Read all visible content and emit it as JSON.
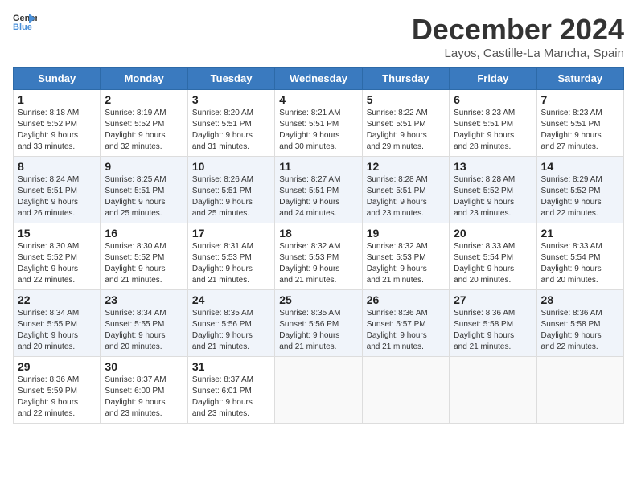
{
  "logo": {
    "text_general": "General",
    "text_blue": "Blue"
  },
  "title": "December 2024",
  "subtitle": "Layos, Castille-La Mancha, Spain",
  "days_of_week": [
    "Sunday",
    "Monday",
    "Tuesday",
    "Wednesday",
    "Thursday",
    "Friday",
    "Saturday"
  ],
  "weeks": [
    [
      {
        "day": "1",
        "info": "Sunrise: 8:18 AM\nSunset: 5:52 PM\nDaylight: 9 hours\nand 33 minutes."
      },
      {
        "day": "2",
        "info": "Sunrise: 8:19 AM\nSunset: 5:52 PM\nDaylight: 9 hours\nand 32 minutes."
      },
      {
        "day": "3",
        "info": "Sunrise: 8:20 AM\nSunset: 5:51 PM\nDaylight: 9 hours\nand 31 minutes."
      },
      {
        "day": "4",
        "info": "Sunrise: 8:21 AM\nSunset: 5:51 PM\nDaylight: 9 hours\nand 30 minutes."
      },
      {
        "day": "5",
        "info": "Sunrise: 8:22 AM\nSunset: 5:51 PM\nDaylight: 9 hours\nand 29 minutes."
      },
      {
        "day": "6",
        "info": "Sunrise: 8:23 AM\nSunset: 5:51 PM\nDaylight: 9 hours\nand 28 minutes."
      },
      {
        "day": "7",
        "info": "Sunrise: 8:23 AM\nSunset: 5:51 PM\nDaylight: 9 hours\nand 27 minutes."
      }
    ],
    [
      {
        "day": "8",
        "info": "Sunrise: 8:24 AM\nSunset: 5:51 PM\nDaylight: 9 hours\nand 26 minutes."
      },
      {
        "day": "9",
        "info": "Sunrise: 8:25 AM\nSunset: 5:51 PM\nDaylight: 9 hours\nand 25 minutes."
      },
      {
        "day": "10",
        "info": "Sunrise: 8:26 AM\nSunset: 5:51 PM\nDaylight: 9 hours\nand 25 minutes."
      },
      {
        "day": "11",
        "info": "Sunrise: 8:27 AM\nSunset: 5:51 PM\nDaylight: 9 hours\nand 24 minutes."
      },
      {
        "day": "12",
        "info": "Sunrise: 8:28 AM\nSunset: 5:51 PM\nDaylight: 9 hours\nand 23 minutes."
      },
      {
        "day": "13",
        "info": "Sunrise: 8:28 AM\nSunset: 5:52 PM\nDaylight: 9 hours\nand 23 minutes."
      },
      {
        "day": "14",
        "info": "Sunrise: 8:29 AM\nSunset: 5:52 PM\nDaylight: 9 hours\nand 22 minutes."
      }
    ],
    [
      {
        "day": "15",
        "info": "Sunrise: 8:30 AM\nSunset: 5:52 PM\nDaylight: 9 hours\nand 22 minutes."
      },
      {
        "day": "16",
        "info": "Sunrise: 8:30 AM\nSunset: 5:52 PM\nDaylight: 9 hours\nand 21 minutes."
      },
      {
        "day": "17",
        "info": "Sunrise: 8:31 AM\nSunset: 5:53 PM\nDaylight: 9 hours\nand 21 minutes."
      },
      {
        "day": "18",
        "info": "Sunrise: 8:32 AM\nSunset: 5:53 PM\nDaylight: 9 hours\nand 21 minutes."
      },
      {
        "day": "19",
        "info": "Sunrise: 8:32 AM\nSunset: 5:53 PM\nDaylight: 9 hours\nand 21 minutes."
      },
      {
        "day": "20",
        "info": "Sunrise: 8:33 AM\nSunset: 5:54 PM\nDaylight: 9 hours\nand 20 minutes."
      },
      {
        "day": "21",
        "info": "Sunrise: 8:33 AM\nSunset: 5:54 PM\nDaylight: 9 hours\nand 20 minutes."
      }
    ],
    [
      {
        "day": "22",
        "info": "Sunrise: 8:34 AM\nSunset: 5:55 PM\nDaylight: 9 hours\nand 20 minutes."
      },
      {
        "day": "23",
        "info": "Sunrise: 8:34 AM\nSunset: 5:55 PM\nDaylight: 9 hours\nand 20 minutes."
      },
      {
        "day": "24",
        "info": "Sunrise: 8:35 AM\nSunset: 5:56 PM\nDaylight: 9 hours\nand 21 minutes."
      },
      {
        "day": "25",
        "info": "Sunrise: 8:35 AM\nSunset: 5:56 PM\nDaylight: 9 hours\nand 21 minutes."
      },
      {
        "day": "26",
        "info": "Sunrise: 8:36 AM\nSunset: 5:57 PM\nDaylight: 9 hours\nand 21 minutes."
      },
      {
        "day": "27",
        "info": "Sunrise: 8:36 AM\nSunset: 5:58 PM\nDaylight: 9 hours\nand 21 minutes."
      },
      {
        "day": "28",
        "info": "Sunrise: 8:36 AM\nSunset: 5:58 PM\nDaylight: 9 hours\nand 22 minutes."
      }
    ],
    [
      {
        "day": "29",
        "info": "Sunrise: 8:36 AM\nSunset: 5:59 PM\nDaylight: 9 hours\nand 22 minutes."
      },
      {
        "day": "30",
        "info": "Sunrise: 8:37 AM\nSunset: 6:00 PM\nDaylight: 9 hours\nand 23 minutes."
      },
      {
        "day": "31",
        "info": "Sunrise: 8:37 AM\nSunset: 6:01 PM\nDaylight: 9 hours\nand 23 minutes."
      },
      {
        "day": "",
        "info": ""
      },
      {
        "day": "",
        "info": ""
      },
      {
        "day": "",
        "info": ""
      },
      {
        "day": "",
        "info": ""
      }
    ]
  ]
}
